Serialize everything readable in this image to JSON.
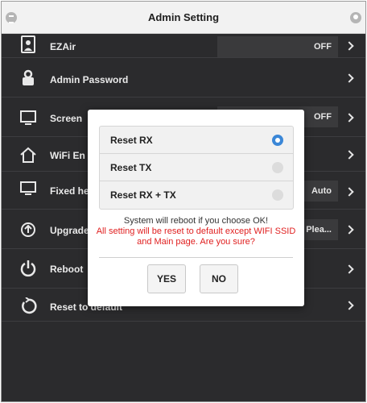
{
  "header": {
    "title": "Admin Setting"
  },
  "rows": [
    {
      "icon": "person-badge-icon",
      "label": "EZAir",
      "value": "OFF"
    },
    {
      "icon": "lock-person-icon",
      "label": "Admin Password"
    },
    {
      "icon": "screen-icon",
      "label": "Screen",
      "value": "OFF"
    },
    {
      "icon": "house-wifi-icon",
      "label": "WiFi En"
    },
    {
      "icon": "monitor-hd-icon",
      "label": "Fixed he",
      "value": "Auto"
    },
    {
      "icon": "upgrade-icon",
      "label": "Upgrade",
      "value": ". Plea..."
    },
    {
      "icon": "power-icon",
      "label": "Reboot"
    },
    {
      "icon": "reset-icon",
      "label": "Reset to default"
    }
  ],
  "dialog": {
    "options": [
      {
        "label": "Reset RX",
        "selected": true
      },
      {
        "label": "Reset TX",
        "selected": false
      },
      {
        "label": "Reset RX + TX",
        "selected": false
      }
    ],
    "message_line1": "System will reboot if you choose OK!",
    "message_line2": "All setting will be reset to default except WIFI SSID and Main page. Are you sure?",
    "yes_label": "YES",
    "no_label": "NO"
  },
  "colors": {
    "accent": "#3b87d7",
    "warning": "#e02020",
    "background": "#2b2b2d"
  }
}
